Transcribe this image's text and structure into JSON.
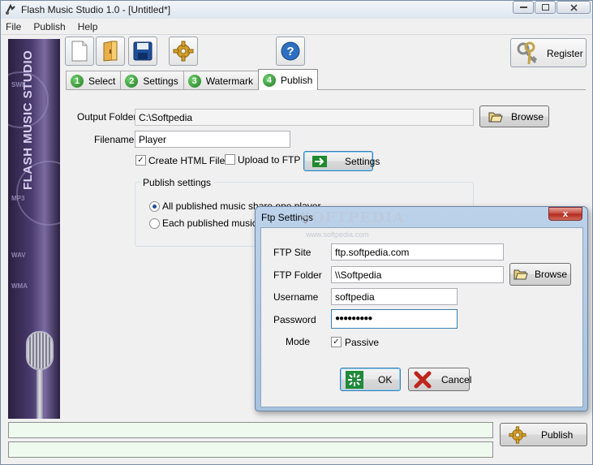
{
  "window": {
    "title": "Flash Music Studio 1.0 - [Untitled*]",
    "controls": [
      "minimize",
      "maximize",
      "close"
    ]
  },
  "menu": [
    "File",
    "Publish",
    "Help"
  ],
  "banner": {
    "title": "FLASH MUSIC STUDIO",
    "formats": [
      "SWF",
      "MP3",
      "WAV",
      "WMA"
    ]
  },
  "toolbar": {
    "buttons": [
      "new-document-icon",
      "open-folder-icon",
      "save-icon",
      "settings-gear-icon",
      "help-icon"
    ],
    "register_label": "Register"
  },
  "tabs": [
    {
      "num": "1",
      "label": "Select"
    },
    {
      "num": "2",
      "label": "Settings"
    },
    {
      "num": "3",
      "label": "Watermark"
    },
    {
      "num": "4",
      "label": "Publish"
    }
  ],
  "publish": {
    "output_folder_label": "Output Folder",
    "output_folder_value": "C:\\Softpedia",
    "browse_label": "Browse",
    "filename_label": "Filename",
    "filename_value": "Player",
    "create_html_label": "Create HTML File",
    "create_html_checked": true,
    "upload_ftp_label": "Upload to FTP",
    "upload_ftp_checked": false,
    "ftp_settings_label": "Settings",
    "group_title": "Publish settings",
    "option_shared": "All published music share one player",
    "option_separate": "Each published music h",
    "selected_option": "shared"
  },
  "ftp_dialog": {
    "title": "Ftp Settings",
    "close_glyph": "x",
    "site_label": "FTP Site",
    "site_value": "ftp.softpedia.com",
    "folder_label": "FTP Folder",
    "folder_value": "\\\\Softpedia",
    "browse_label": "Browse",
    "username_label": "Username",
    "username_value": "softpedia",
    "password_label": "Password",
    "password_value": "●●●●●●●●●",
    "mode_label": "Mode",
    "passive_label": "Passive",
    "passive_checked": true,
    "ok_label": "OK",
    "cancel_label": "Cancel"
  },
  "watermark": {
    "text": "SOFTPEDIA",
    "url": "www.softpedia.com"
  },
  "status": {
    "line1": "",
    "line2": "",
    "publish_label": "Publish"
  },
  "colors": {
    "status_bg": "#eefaee",
    "tab_number": "#2e8b2e",
    "dialog_frame": "#a7c2df",
    "close_red": "#c4473a"
  }
}
